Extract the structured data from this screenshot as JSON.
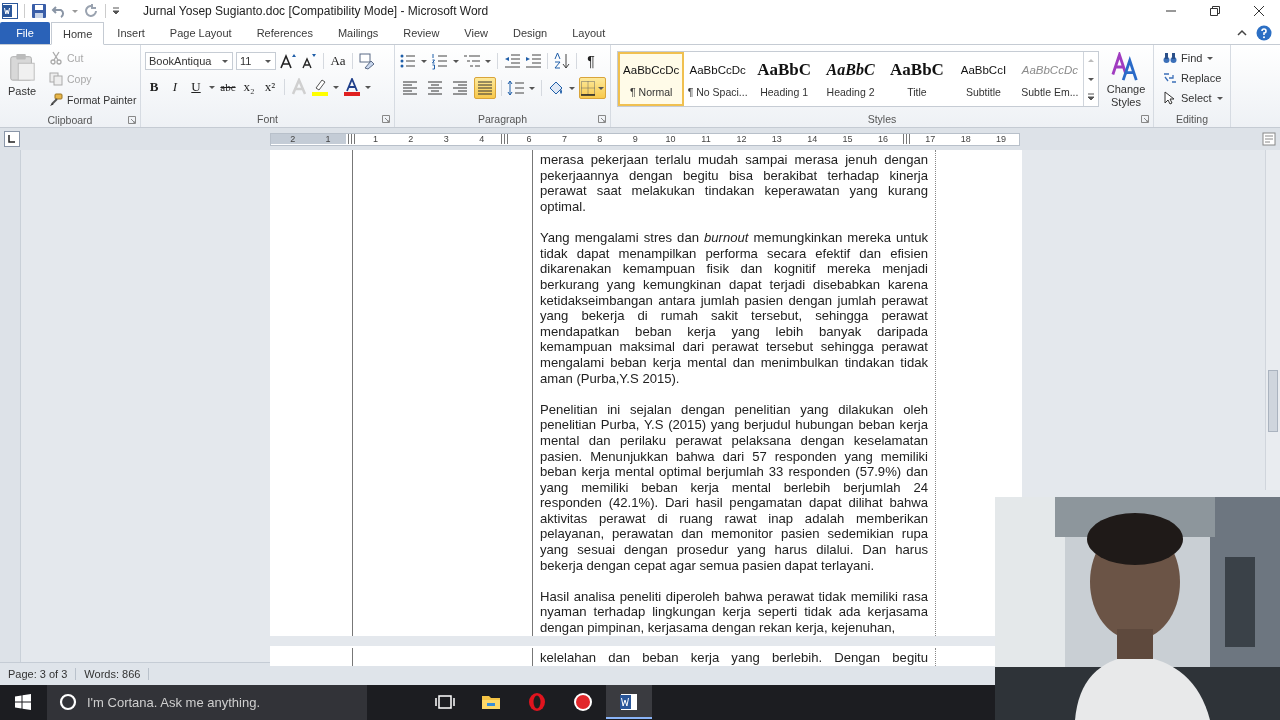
{
  "window": {
    "title": "Jurnal Yosep Sugianto.doc [Compatibility Mode]  -  Microsoft Word"
  },
  "tabs": [
    {
      "label": "File",
      "kind": "file",
      "selected": false
    },
    {
      "label": "Home",
      "kind": "tab",
      "selected": true
    },
    {
      "label": "Insert",
      "kind": "tab",
      "selected": false
    },
    {
      "label": "Page Layout",
      "kind": "tab",
      "selected": false
    },
    {
      "label": "References",
      "kind": "tab",
      "selected": false
    },
    {
      "label": "Mailings",
      "kind": "tab",
      "selected": false
    },
    {
      "label": "Review",
      "kind": "tab",
      "selected": false
    },
    {
      "label": "View",
      "kind": "tab",
      "selected": false
    },
    {
      "label": "Design",
      "kind": "tab",
      "selected": false
    },
    {
      "label": "Layout",
      "kind": "tab",
      "selected": false
    }
  ],
  "clipboard": {
    "group": "Clipboard",
    "paste": "Paste",
    "items": [
      {
        "label": "Cut",
        "kind": "cut",
        "disabled": true
      },
      {
        "label": "Copy",
        "kind": "copy",
        "disabled": true
      },
      {
        "label": "Format Painter",
        "kind": "painter",
        "disabled": false
      }
    ]
  },
  "font": {
    "group": "Font",
    "name": "BookAntiqua",
    "size": "11",
    "case": "Aa",
    "formats": [
      "B",
      "I",
      "U",
      "abc",
      "x₂",
      "x²"
    ]
  },
  "paragraph": {
    "group": "Paragraph",
    "pilcrow": "¶",
    "align": [
      {
        "selected": false
      },
      {
        "selected": false
      },
      {
        "selected": false
      },
      {
        "selected": true
      }
    ],
    "borders_selected": true
  },
  "styles": {
    "group": "Styles",
    "change": "Change Styles",
    "items": [
      {
        "sample": "AaBbCcDc",
        "label": "¶ Normal",
        "kind": "normal",
        "selected": true
      },
      {
        "sample": "AaBbCcDc",
        "label": "¶ No Spaci...",
        "kind": "normal",
        "selected": false
      },
      {
        "sample": "AaBbC",
        "label": "Heading 1",
        "kind": "heading",
        "selected": false
      },
      {
        "sample": "AaBbC",
        "label": "Heading 2",
        "kind": "italic",
        "selected": false
      },
      {
        "sample": "AaBbC",
        "label": "Title",
        "kind": "heading",
        "selected": false
      },
      {
        "sample": "AaBbCcI",
        "label": "Subtitle",
        "kind": "normal",
        "selected": false
      },
      {
        "sample": "AaBbCcDc",
        "label": "Subtle Em...",
        "kind": "subtle",
        "selected": false
      }
    ]
  },
  "editing": {
    "group": "Editing",
    "items": [
      {
        "label": "Find",
        "kind": "find"
      },
      {
        "label": "Replace",
        "kind": "replace"
      },
      {
        "label": "Select",
        "kind": "select"
      }
    ]
  },
  "ruler": {
    "segments": [
      [
        "2",
        "1"
      ],
      [
        "1",
        "2",
        "3",
        "4"
      ],
      [
        "6",
        "7",
        "8",
        "9",
        "10",
        "11",
        "12",
        "13",
        "14",
        "15",
        "16"
      ],
      [
        "17",
        "18",
        "19"
      ]
    ]
  },
  "document": {
    "paragraphs": [
      "merasa pekerjaan terlalu mudah sampai merasa jenuh dengan pekerjaannya dengan begitu bisa berakibat terhadap kinerja perawat saat melakukan tindakan keperawatan yang kurang optimal.",
      "Yang mengalami stres dan *burnout* memungkinkan mereka untuk tidak dapat menampilkan performa secara efektif dan efisien dikarenakan kemampuan fisik dan kognitif mereka menjadi berkurang yang kemungkinan dapat terjadi disebabkan karena ketidakseimbangan antara jumlah pasien dengan jumlah perawat yang bekerja di rumah sakit tersebut, sehingga perawat mendapatkan beban kerja yang lebih banyak daripada kemampuan maksimal dari perawat tersebut sehingga perawat mengalami beban kerja mental dan menimbulkan tindakan tidak aman (Purba,Y.S 2015).",
      "Penelitian ini sejalan dengan penelitian yang dilakukan oleh penelitian Purba, Y.S (2015) yang berjudul hubungan beban kerja mental dan perilaku perawat pelaksana dengan keselamatan pasien. Menunjukkan bahwa dari 57 responden yang memiliki beban kerja mental optimal berjumlah 33 responden (57.9%) dan yang memiliki beban kerja mental berlebih berjumlah 24 responden (42.1%). Dari hasil pengamatan dapat dilihat bahwa aktivitas perawat di ruang rawat inap adalah memberikan pelayanan, perawatan dan memonitor pasien sedemikian rupa yang sesuai dengan prosedur yang harus dilalui. Dan harus bekerja dengan cepat agar semua pasien dapat terlayani.",
      "Hasil analisa peneliti diperoleh bahwa perawat tidak memiliki rasa nyaman terhadap lingkungan kerja seperti tidak ada kerjasama dengan pimpinan, kerjasama dengan rekan kerja, kejenuhan,"
    ],
    "next_page_line": "kelelahan dan beban kerja yang berlebih. Dengan begitu"
  },
  "status_bar": {
    "page": "Page: 3 of 3",
    "words": "Words: 866"
  },
  "taskbar": {
    "search": "I'm Cortana. Ask me anything."
  }
}
